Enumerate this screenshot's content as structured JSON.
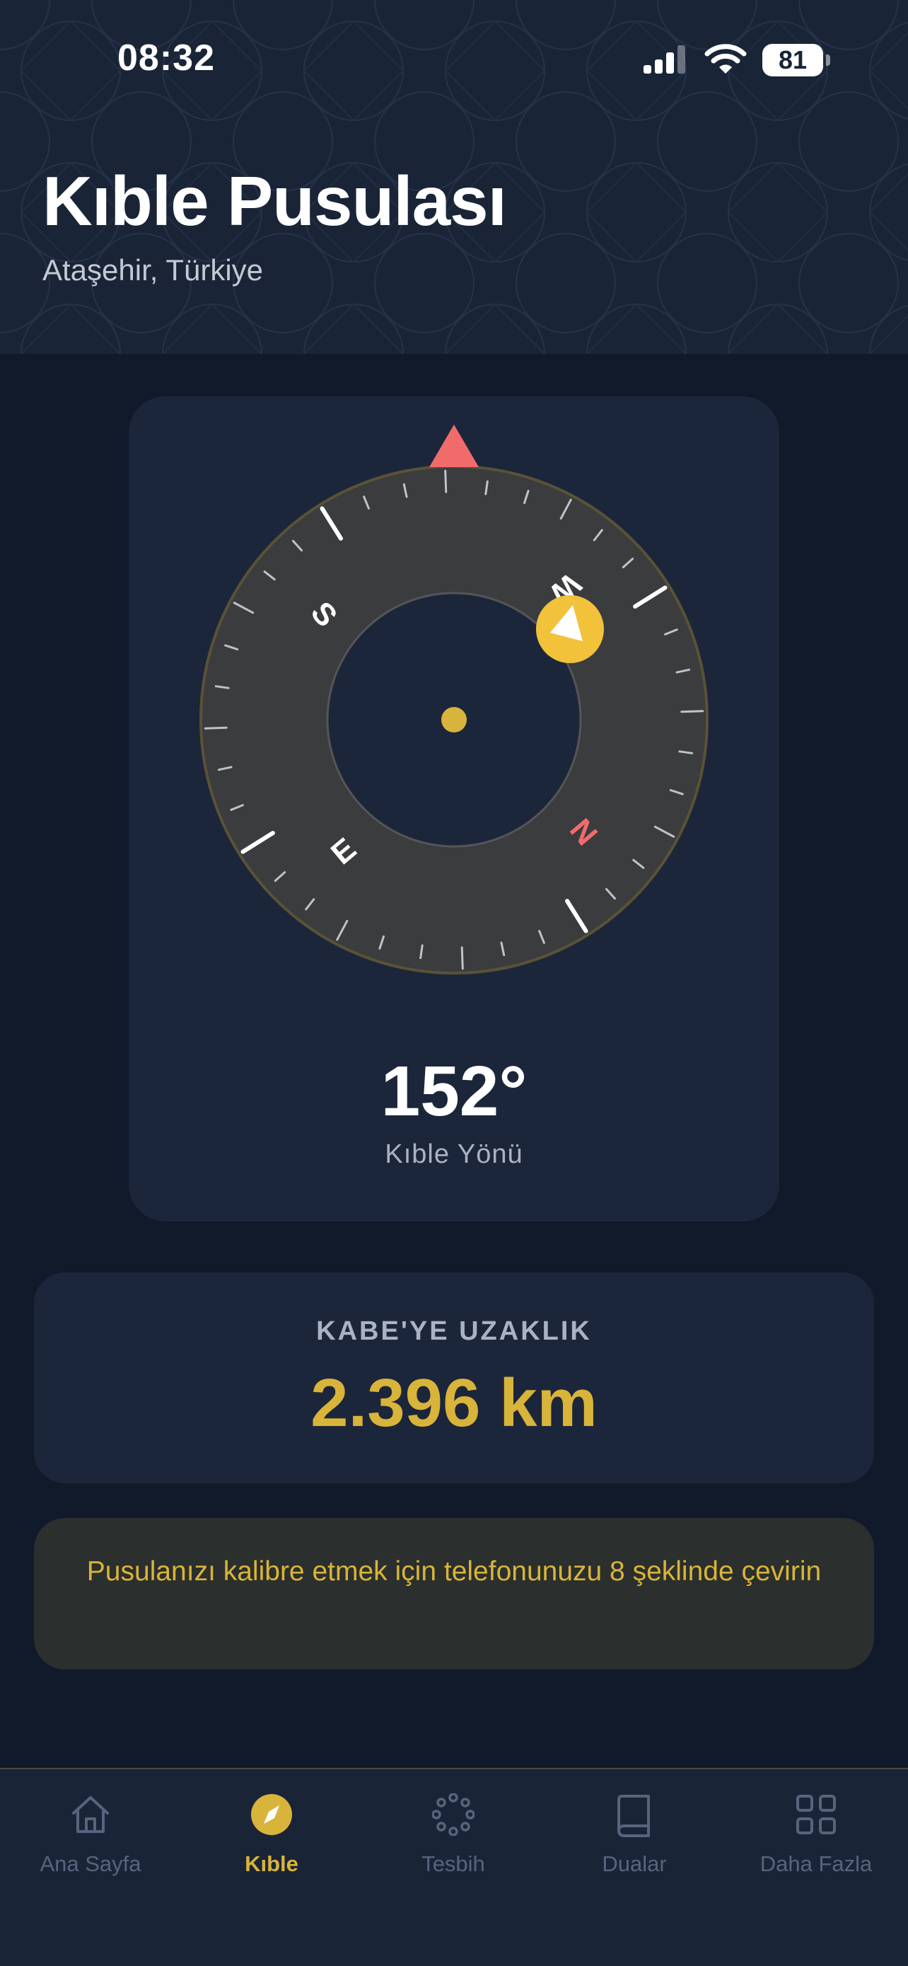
{
  "status_bar": {
    "time": "08:32",
    "battery": "81",
    "icons": [
      "signal-icon",
      "wifi-icon",
      "battery-icon"
    ]
  },
  "header": {
    "title": "Kıble Pusulası",
    "location": "Ataşehir, Türkiye"
  },
  "compass": {
    "cardinals": {
      "north": "N",
      "east": "E",
      "south": "S",
      "west": "W"
    },
    "pointer_icon": "north-pointer-icon",
    "qibla_icon": "kaaba-direction-icon",
    "heading": "152°",
    "heading_label": "Kıble Yönü",
    "colors": {
      "north": "#f26b6b",
      "qibla": "#f2c23a",
      "ring": "#3a3c3e"
    }
  },
  "distance": {
    "label": "KABE'YE UZAKLIK",
    "value": "2.396 km"
  },
  "calibration": {
    "message": "Pusulanızı kalibre etmek için telefonunuzu 8 şeklinde çevirin"
  },
  "tabbar": {
    "tabs": [
      {
        "label": "Ana Sayfa",
        "icon": "home-icon",
        "active": false
      },
      {
        "label": "Kıble",
        "icon": "compass-icon",
        "active": true
      },
      {
        "label": "Tesbih",
        "icon": "prayer-beads-icon",
        "active": false
      },
      {
        "label": "Dualar",
        "icon": "book-icon",
        "active": false
      },
      {
        "label": "Daha Fazla",
        "icon": "grid-icon",
        "active": false
      }
    ]
  },
  "theme": {
    "background": "#111a2a",
    "card": "#1c263b",
    "accent": "#d9b43a",
    "muted": "#56647d"
  }
}
